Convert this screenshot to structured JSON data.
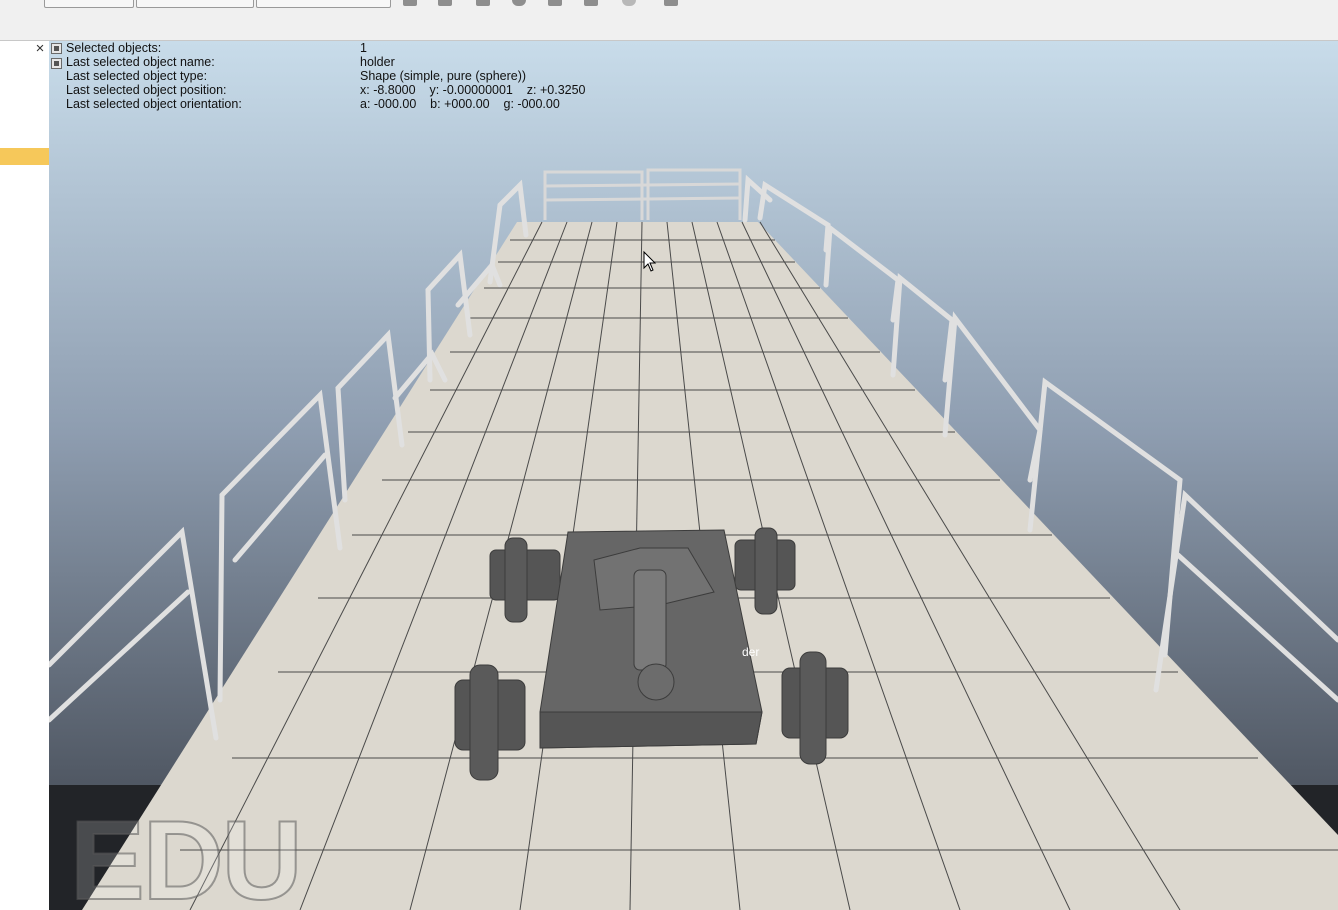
{
  "info_panel": {
    "rows": [
      {
        "label": "Selected objects:",
        "value": "1"
      },
      {
        "label": "Last selected object name:",
        "value": "holder"
      },
      {
        "label": "Last selected object type:",
        "value": "Shape (simple, pure (sphere))"
      },
      {
        "label": "Last selected object position:",
        "value": "x: -8.8000    y: -0.00000001    z: +0.3250"
      },
      {
        "label": "Last selected object orientation:",
        "value": "a: -000.00    b: +000.00    g: -000.00"
      }
    ]
  },
  "left_panel": {
    "close_glyph": "×"
  },
  "viewport": {
    "watermark": "EDU",
    "object_label": "der",
    "sky_top_color": "#c8dcea",
    "sky_bottom_color": "#3a3f48",
    "floor_color": "#dcd8cf",
    "robot_color": "#5e5e5e"
  },
  "icons": [
    "close-icon",
    "mouse-cursor-icon",
    "play-icon",
    "pause-icon",
    "stop-icon"
  ]
}
